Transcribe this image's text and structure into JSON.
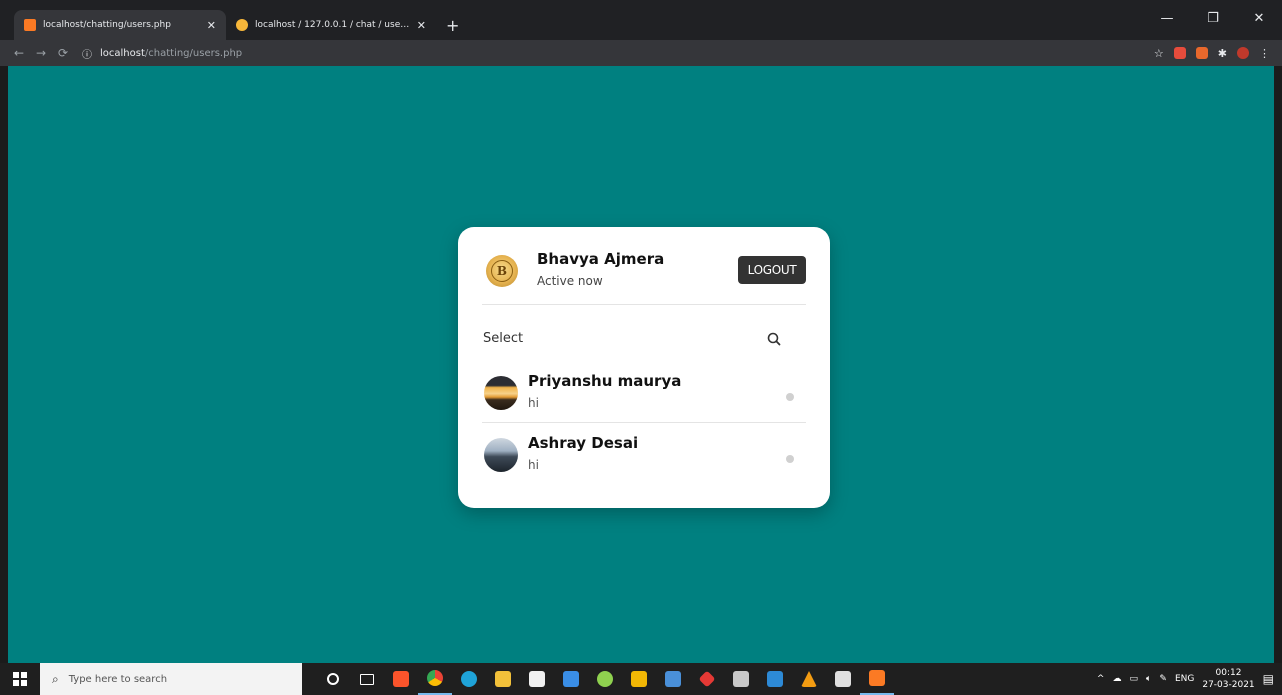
{
  "browser": {
    "tabs": [
      {
        "title": "localhost/chatting/users.php",
        "active": true
      },
      {
        "title": "localhost / 127.0.0.1 / chat / users | php",
        "active": false
      }
    ],
    "url_host": "localhost",
    "url_path": "/chatting/users.php"
  },
  "chat": {
    "current_user": {
      "name": "Bhavya Ajmera",
      "status": "Active now",
      "avatar_letter": "B"
    },
    "logout_label": "LOGOUT",
    "search_label": "Select",
    "users": [
      {
        "name": "Priyanshu maurya",
        "last_message": "hi"
      },
      {
        "name": "Ashray Desai",
        "last_message": "hi"
      }
    ]
  },
  "taskbar": {
    "search_placeholder": "Type here to search",
    "language": "ENG",
    "time": "00:12",
    "date": "27-03-2021"
  },
  "colors": {
    "page_background": "#008080",
    "card_background": "#ffffff",
    "logout_button": "#333333",
    "offline_dot": "#d0d0d0"
  }
}
